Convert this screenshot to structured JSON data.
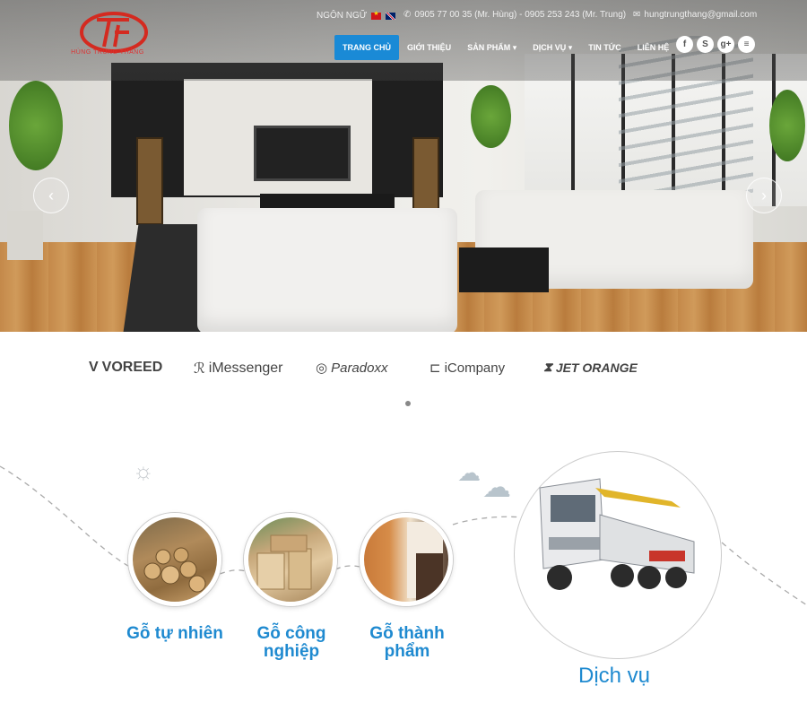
{
  "header": {
    "logo_text": "HÙNG TRUNG THẮNG",
    "language_label": "NGÔN NGỮ",
    "phone": "0905 77 00 35 (Mr. Hùng) - 0905 253 243 (Mr. Trung)",
    "email": "hungtrungthang@gmail.com"
  },
  "nav": {
    "items": [
      {
        "label": "TRANG CHỦ"
      },
      {
        "label": "GIỚI THIỆU"
      },
      {
        "label": "SẢN PHẨM ▾"
      },
      {
        "label": "DỊCH VỤ ▾"
      },
      {
        "label": "TIN TỨC"
      },
      {
        "label": "LIÊN HỆ"
      }
    ],
    "accent_color": "#1a8ad6"
  },
  "social": [
    "f",
    "S",
    "g+",
    "≡"
  ],
  "hero": {
    "prev_icon": "‹",
    "next_icon": "›"
  },
  "partners": [
    {
      "label": "VOREED",
      "icon": "V"
    },
    {
      "label": "iMessenger",
      "icon": "ℛ"
    },
    {
      "label": "Paradoxx",
      "icon": "◎"
    },
    {
      "label": "iCompany",
      "icon": "⊏"
    },
    {
      "label": "JET ORANGE",
      "icon": "⧗"
    }
  ],
  "services": [
    {
      "label": "Gỗ tự nhiên"
    },
    {
      "label": "Gỗ công nghiệp"
    },
    {
      "label": "Gỗ thành phẩm"
    }
  ],
  "featured_service": {
    "label": "Dịch vụ"
  }
}
